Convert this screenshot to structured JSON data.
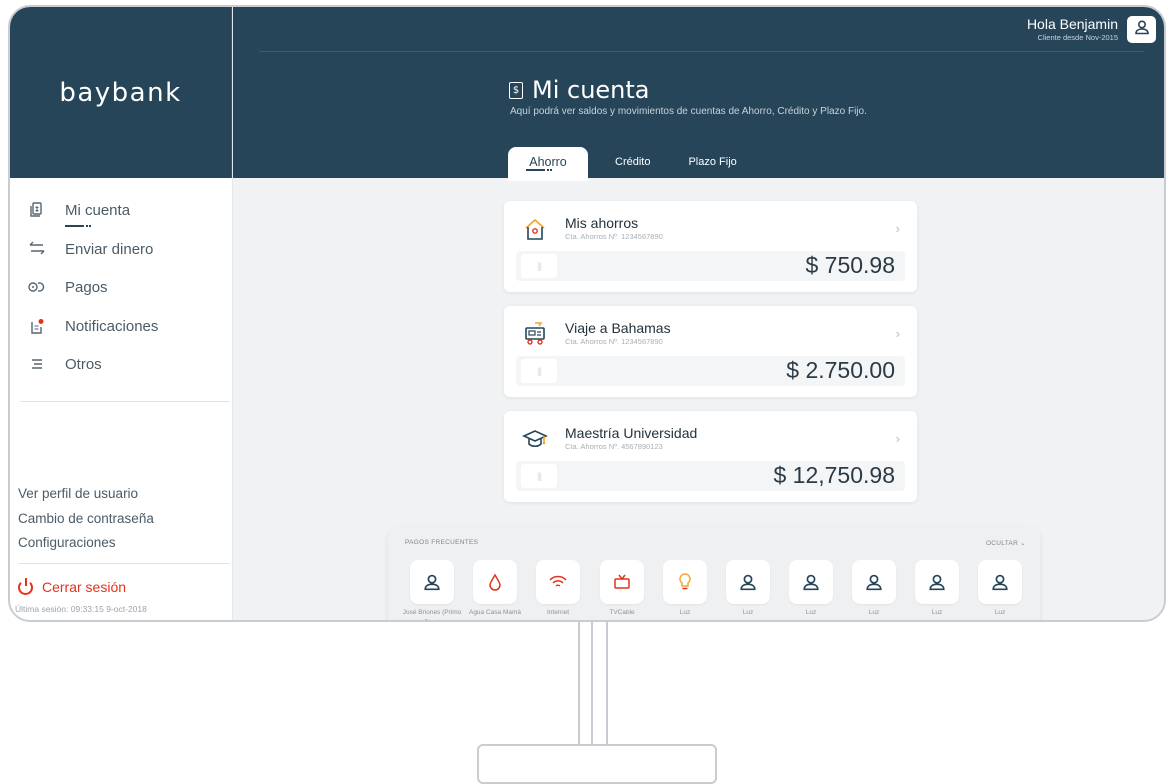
{
  "brand": "baybank",
  "user": {
    "greeting": "Hola Benjamin",
    "since": "Cliente desde Nov-2015"
  },
  "page": {
    "title": "Mi cuenta",
    "subtitle": "Aquí podrá ver saldos y movimientos de cuentas de Ahorro, Crédito y Plazo Fijo."
  },
  "tabs": [
    {
      "label": "Ahorro",
      "active": true
    },
    {
      "label": "Crédito",
      "active": false
    },
    {
      "label": "Plazo Fijo",
      "active": false
    }
  ],
  "nav": [
    {
      "label": "Mi cuenta",
      "icon": "account-icon",
      "active": true
    },
    {
      "label": "Enviar dinero",
      "icon": "transfer-icon"
    },
    {
      "label": "Pagos",
      "icon": "payments-icon"
    },
    {
      "label": "Notificaciones",
      "icon": "notifications-icon"
    },
    {
      "label": "Otros",
      "icon": "menu-icon"
    }
  ],
  "links": {
    "profile": "Ver perfil de usuario",
    "password": "Cambio de contraseña",
    "settings": "Configuraciones"
  },
  "logout": "Cerrar sesión",
  "last_session": "Última sesión: 09:33:15 9-oct-2018",
  "accounts": [
    {
      "name": "Mis ahorros",
      "number": "Cta. Ahorros Nº. 1234567890",
      "amount": "$ 750.98",
      "icon": "house-icon"
    },
    {
      "name": "Viaje a Bahamas",
      "number": "Cta. Ahorros Nº. 1234567890",
      "amount": "$ 2.750.00",
      "icon": "travel-cart-icon"
    },
    {
      "name": "Maestría Universidad",
      "number": "Cta. Ahorros Nº. 4567890123",
      "amount": "$ 12,750.98",
      "icon": "graduation-cap-icon"
    }
  ],
  "frequent": {
    "title": "PAGOS FRECUENTES",
    "hide": "OCULTAR",
    "items": [
      {
        "label": "José Briones (Primo Pipo)",
        "icon": "person-icon"
      },
      {
        "label": "Agua Casa Mamá",
        "icon": "water-drop-icon"
      },
      {
        "label": "Internet",
        "icon": "wifi-icon"
      },
      {
        "label": "TVCable",
        "icon": "tv-icon"
      },
      {
        "label": "Luz",
        "icon": "lightbulb-icon"
      },
      {
        "label": "Luz",
        "icon": "person-icon"
      },
      {
        "label": "Luz",
        "icon": "person-icon"
      },
      {
        "label": "Luz",
        "icon": "person-icon"
      },
      {
        "label": "Luz",
        "icon": "person-icon"
      },
      {
        "label": "Luz",
        "icon": "person-icon"
      }
    ]
  },
  "colors": {
    "primary": "#264559",
    "accent_red": "#e2331d",
    "accent_orange": "#f4a32b"
  }
}
